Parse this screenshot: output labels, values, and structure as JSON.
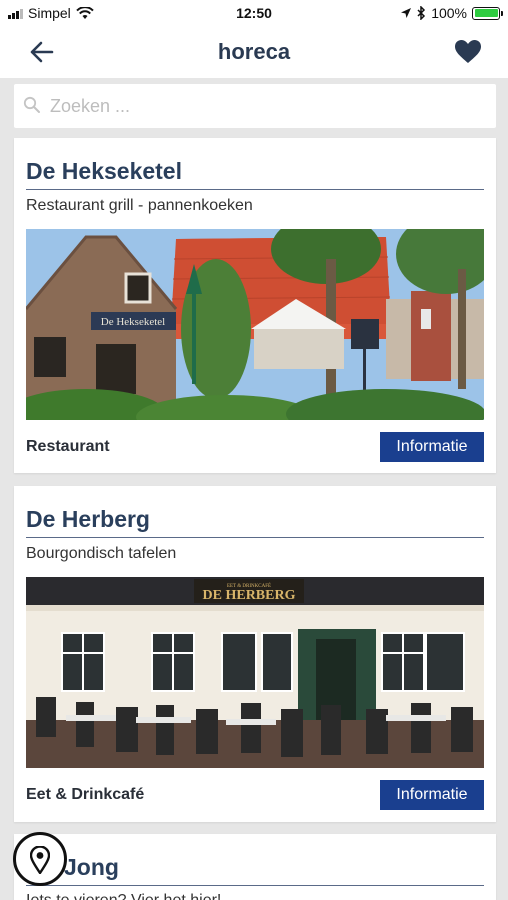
{
  "status_bar": {
    "carrier": "Simpel",
    "time": "12:50",
    "battery_percent": "100%",
    "battery_level": 1.0,
    "icons": [
      "signal-icon",
      "wifi-icon",
      "location-arrow-icon",
      "bluetooth-icon",
      "battery-icon"
    ]
  },
  "nav": {
    "title": "horeca",
    "back_icon": "back-arrow-icon",
    "favorite_icon": "heart-icon"
  },
  "search": {
    "placeholder": "Zoeken ...",
    "value": ""
  },
  "listings": [
    {
      "title": "De Hekseketel",
      "subtitle": "Restaurant grill - pannenkoeken",
      "sign_text": "De Hekseketel",
      "type": "Restaurant",
      "button_label": "Informatie"
    },
    {
      "title": "De Herberg",
      "subtitle": "Bourgondisch tafelen",
      "sign_text": "DE HERBERG",
      "sign_small": "EET & DRINKCAFÉ",
      "type": "Eet & Drinkcafé",
      "button_label": "Informatie"
    },
    {
      "title": "Jong",
      "subtitle": "Iets te vieren? Vier het hier!"
    }
  ],
  "map_button": {
    "icon": "map-pin-icon"
  },
  "colors": {
    "accent_blue": "#1a3f8f",
    "title_navy": "#2a3f5c",
    "background": "#e6e6e6"
  }
}
